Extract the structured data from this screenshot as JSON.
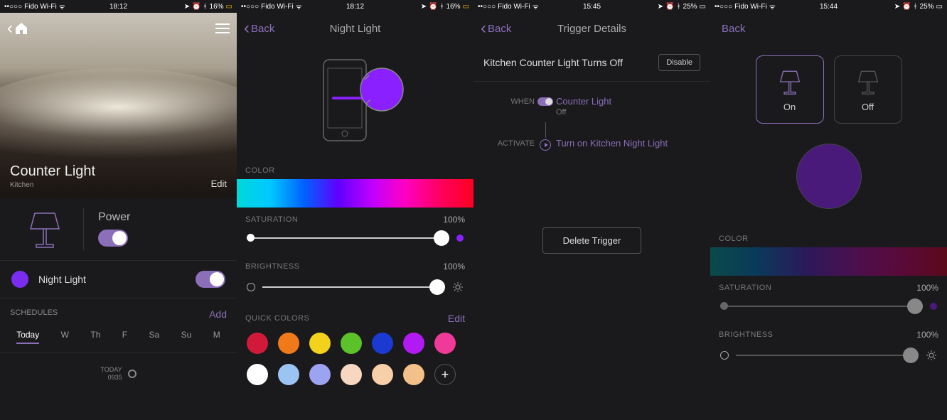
{
  "screen1": {
    "status": {
      "carrier": "Fido Wi-Fi",
      "time": "18:12",
      "battery": "16%"
    },
    "title": "Counter Light",
    "subtitle": "Kitchen",
    "edit": "Edit",
    "power_label": "Power",
    "night_light": "Night Light",
    "night_color": "#7a2cf0",
    "schedules_label": "SCHEDULES",
    "add": "Add",
    "days": [
      "Today",
      "W",
      "Th",
      "F",
      "Sa",
      "Su",
      "M"
    ],
    "today_marker": "TODAY",
    "today_time": "0935"
  },
  "screen2": {
    "status": {
      "carrier": "Fido Wi-Fi",
      "time": "18:12",
      "battery": "16%"
    },
    "back": "Back",
    "title": "Night Light",
    "preview_color": "#8a20ff",
    "color_label": "COLOR",
    "saturation_label": "SATURATION",
    "saturation_value": "100%",
    "sat_end_color": "#8a20ff",
    "brightness_label": "BRIGHTNESS",
    "brightness_value": "100%",
    "quick_label": "QUICK COLORS",
    "edit": "Edit",
    "swatches": [
      "#d11a3a",
      "#f07a1a",
      "#f2d21a",
      "#5cc22a",
      "#1a3ad1",
      "#b11af2",
      "#f03a9a",
      "#ffffff",
      "#9cc4f2",
      "#9ca4f2",
      "#f7d7c0",
      "#f7cfa8",
      "#f2c088"
    ]
  },
  "screen3": {
    "status": {
      "carrier": "Fido Wi-Fi",
      "time": "15:45",
      "battery": "25%"
    },
    "back": "Back",
    "title": "Trigger Details",
    "trigger_name": "Kitchen Counter Light Turns Off",
    "disable": "Disable",
    "when_label": "WHEN",
    "when_text": "Counter Light",
    "when_sub": "Off",
    "activate_label": "ACTIVATE",
    "activate_text": "Turn on Kitchen Night Light",
    "delete": "Delete Trigger"
  },
  "screen4": {
    "status": {
      "carrier": "Fido Wi-Fi",
      "time": "15:44",
      "battery": "25%"
    },
    "back": "Back",
    "on": "On",
    "off": "Off",
    "ball_color": "#4a1a7a",
    "color_label": "COLOR",
    "saturation_label": "SATURATION",
    "saturation_value": "100%",
    "brightness_label": "BRIGHTNESS",
    "brightness_value": "100%"
  }
}
